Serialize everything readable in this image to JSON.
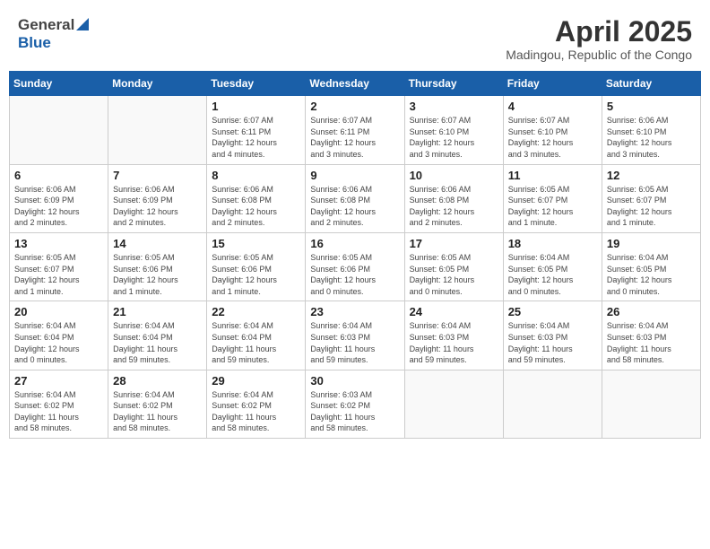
{
  "header": {
    "logo_general": "General",
    "logo_blue": "Blue",
    "month_title": "April 2025",
    "location": "Madingou, Republic of the Congo"
  },
  "weekdays": [
    "Sunday",
    "Monday",
    "Tuesday",
    "Wednesday",
    "Thursday",
    "Friday",
    "Saturday"
  ],
  "weeks": [
    [
      {
        "day": "",
        "info": ""
      },
      {
        "day": "",
        "info": ""
      },
      {
        "day": "1",
        "info": "Sunrise: 6:07 AM\nSunset: 6:11 PM\nDaylight: 12 hours\nand 4 minutes."
      },
      {
        "day": "2",
        "info": "Sunrise: 6:07 AM\nSunset: 6:11 PM\nDaylight: 12 hours\nand 3 minutes."
      },
      {
        "day": "3",
        "info": "Sunrise: 6:07 AM\nSunset: 6:10 PM\nDaylight: 12 hours\nand 3 minutes."
      },
      {
        "day": "4",
        "info": "Sunrise: 6:07 AM\nSunset: 6:10 PM\nDaylight: 12 hours\nand 3 minutes."
      },
      {
        "day": "5",
        "info": "Sunrise: 6:06 AM\nSunset: 6:10 PM\nDaylight: 12 hours\nand 3 minutes."
      }
    ],
    [
      {
        "day": "6",
        "info": "Sunrise: 6:06 AM\nSunset: 6:09 PM\nDaylight: 12 hours\nand 2 minutes."
      },
      {
        "day": "7",
        "info": "Sunrise: 6:06 AM\nSunset: 6:09 PM\nDaylight: 12 hours\nand 2 minutes."
      },
      {
        "day": "8",
        "info": "Sunrise: 6:06 AM\nSunset: 6:08 PM\nDaylight: 12 hours\nand 2 minutes."
      },
      {
        "day": "9",
        "info": "Sunrise: 6:06 AM\nSunset: 6:08 PM\nDaylight: 12 hours\nand 2 minutes."
      },
      {
        "day": "10",
        "info": "Sunrise: 6:06 AM\nSunset: 6:08 PM\nDaylight: 12 hours\nand 2 minutes."
      },
      {
        "day": "11",
        "info": "Sunrise: 6:05 AM\nSunset: 6:07 PM\nDaylight: 12 hours\nand 1 minute."
      },
      {
        "day": "12",
        "info": "Sunrise: 6:05 AM\nSunset: 6:07 PM\nDaylight: 12 hours\nand 1 minute."
      }
    ],
    [
      {
        "day": "13",
        "info": "Sunrise: 6:05 AM\nSunset: 6:07 PM\nDaylight: 12 hours\nand 1 minute."
      },
      {
        "day": "14",
        "info": "Sunrise: 6:05 AM\nSunset: 6:06 PM\nDaylight: 12 hours\nand 1 minute."
      },
      {
        "day": "15",
        "info": "Sunrise: 6:05 AM\nSunset: 6:06 PM\nDaylight: 12 hours\nand 1 minute."
      },
      {
        "day": "16",
        "info": "Sunrise: 6:05 AM\nSunset: 6:06 PM\nDaylight: 12 hours\nand 0 minutes."
      },
      {
        "day": "17",
        "info": "Sunrise: 6:05 AM\nSunset: 6:05 PM\nDaylight: 12 hours\nand 0 minutes."
      },
      {
        "day": "18",
        "info": "Sunrise: 6:04 AM\nSunset: 6:05 PM\nDaylight: 12 hours\nand 0 minutes."
      },
      {
        "day": "19",
        "info": "Sunrise: 6:04 AM\nSunset: 6:05 PM\nDaylight: 12 hours\nand 0 minutes."
      }
    ],
    [
      {
        "day": "20",
        "info": "Sunrise: 6:04 AM\nSunset: 6:04 PM\nDaylight: 12 hours\nand 0 minutes."
      },
      {
        "day": "21",
        "info": "Sunrise: 6:04 AM\nSunset: 6:04 PM\nDaylight: 11 hours\nand 59 minutes."
      },
      {
        "day": "22",
        "info": "Sunrise: 6:04 AM\nSunset: 6:04 PM\nDaylight: 11 hours\nand 59 minutes."
      },
      {
        "day": "23",
        "info": "Sunrise: 6:04 AM\nSunset: 6:03 PM\nDaylight: 11 hours\nand 59 minutes."
      },
      {
        "day": "24",
        "info": "Sunrise: 6:04 AM\nSunset: 6:03 PM\nDaylight: 11 hours\nand 59 minutes."
      },
      {
        "day": "25",
        "info": "Sunrise: 6:04 AM\nSunset: 6:03 PM\nDaylight: 11 hours\nand 59 minutes."
      },
      {
        "day": "26",
        "info": "Sunrise: 6:04 AM\nSunset: 6:03 PM\nDaylight: 11 hours\nand 58 minutes."
      }
    ],
    [
      {
        "day": "27",
        "info": "Sunrise: 6:04 AM\nSunset: 6:02 PM\nDaylight: 11 hours\nand 58 minutes."
      },
      {
        "day": "28",
        "info": "Sunrise: 6:04 AM\nSunset: 6:02 PM\nDaylight: 11 hours\nand 58 minutes."
      },
      {
        "day": "29",
        "info": "Sunrise: 6:04 AM\nSunset: 6:02 PM\nDaylight: 11 hours\nand 58 minutes."
      },
      {
        "day": "30",
        "info": "Sunrise: 6:03 AM\nSunset: 6:02 PM\nDaylight: 11 hours\nand 58 minutes."
      },
      {
        "day": "",
        "info": ""
      },
      {
        "day": "",
        "info": ""
      },
      {
        "day": "",
        "info": ""
      }
    ]
  ]
}
